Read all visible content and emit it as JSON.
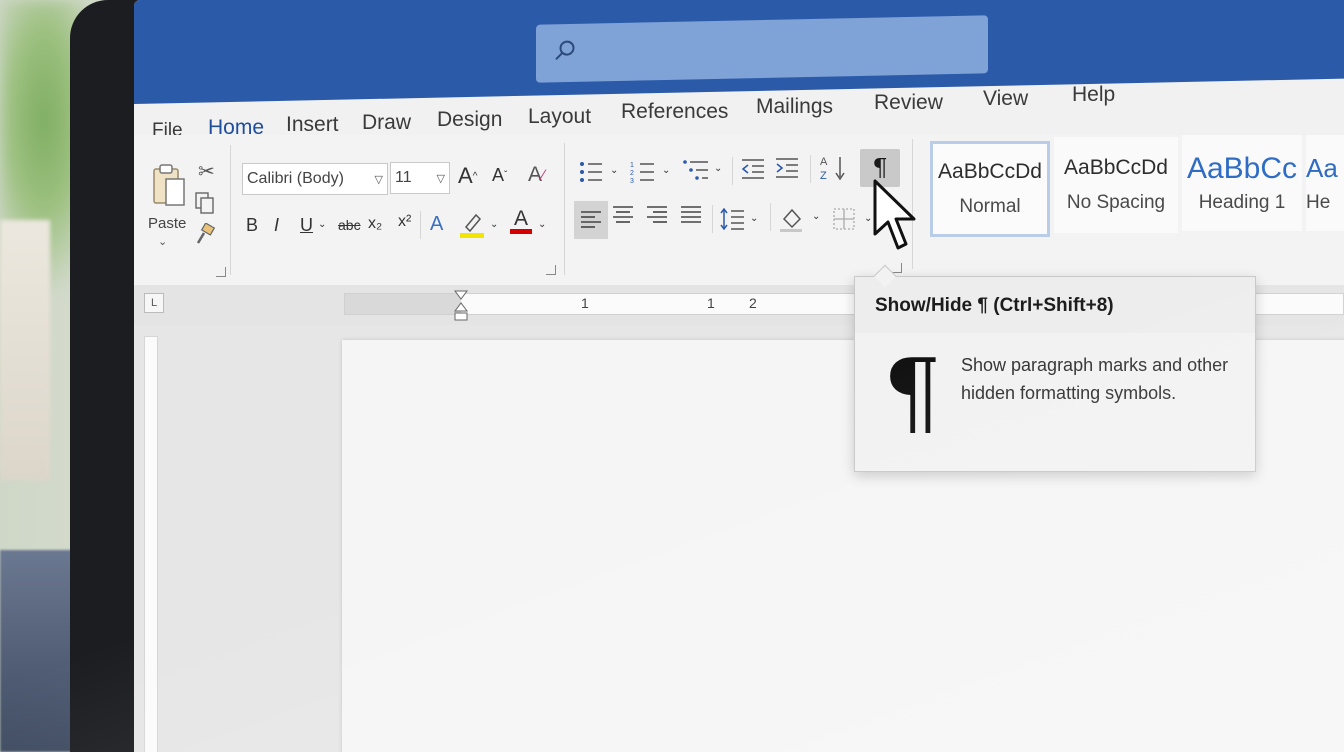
{
  "menu": {
    "items": [
      "File",
      "Home",
      "Insert",
      "Draw",
      "Design",
      "Layout",
      "References",
      "Mailings",
      "Review",
      "View",
      "Help"
    ],
    "active": "Home"
  },
  "clipboard": {
    "paste_label": "Paste"
  },
  "font": {
    "name": "Calibri (Body)",
    "size": "11"
  },
  "formatting": {
    "bold": "B",
    "italic": "I",
    "underline": "U",
    "strikethrough": "abc",
    "subscript": "x₂",
    "superscript": "x²",
    "grow_font": "A^",
    "shrink_font": "Aˇ",
    "font_color": "A",
    "text_effects": "A"
  },
  "colors": {
    "titlebar": "#2b5aa8",
    "accent": "#2b5aa8",
    "highlight": "#f2e600",
    "font_color": "#d40000",
    "heading_blue": "#2f6cc4"
  },
  "paragraph": {
    "pilcrow_button": "¶",
    "sort": "A↓Z"
  },
  "styles": [
    {
      "sample": "AaBbCcDd",
      "name": "Normal"
    },
    {
      "sample": "AaBbCcDd",
      "name": "No Spacing"
    },
    {
      "sample": "AaBbCc",
      "name": "Heading 1"
    },
    {
      "sample": "Aa",
      "name": "He"
    }
  ],
  "ruler": {
    "numbers": [
      "1",
      "1",
      "2"
    ]
  },
  "tooltip": {
    "title": "Show/Hide ¶ (Ctrl+Shift+8)",
    "symbol": "¶",
    "description": "Show paragraph marks and other hidden formatting symbols."
  }
}
